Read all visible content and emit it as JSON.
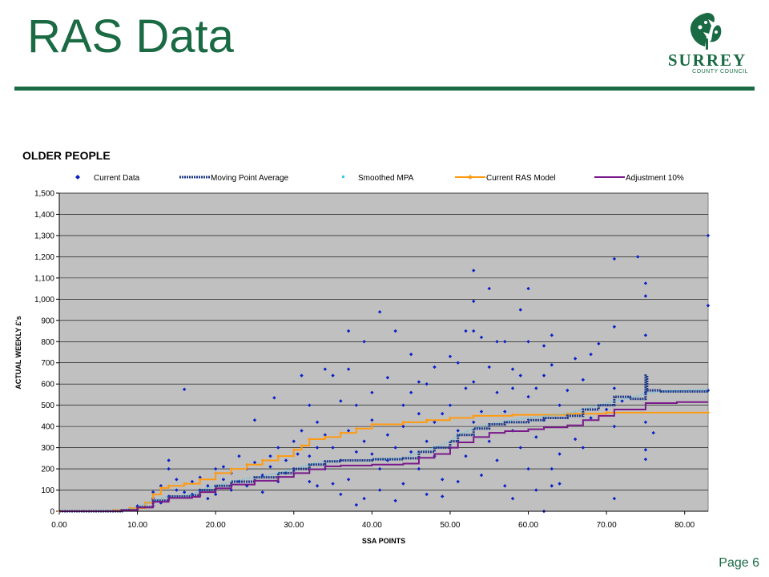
{
  "slide": {
    "title": "RAS Data",
    "page_label": "Page 6",
    "logo_name": "SURREY",
    "logo_sub": "COUNTY COUNCIL",
    "accent_color": "#1a6b44"
  },
  "chart_data": {
    "type": "scatter",
    "title": "OLDER PEOPLE",
    "xlabel": "SSA POINTS",
    "ylabel": "ACTUAL WEEKLY £'s",
    "xlim": [
      0,
      83
    ],
    "ylim": [
      0,
      1500
    ],
    "x_ticks": [
      "0.00",
      "10.00",
      "20.00",
      "30.00",
      "40.00",
      "50.00",
      "60.00",
      "70.00",
      "80.00"
    ],
    "y_ticks": [
      "0",
      "100",
      "200",
      "300",
      "400",
      "500",
      "600",
      "700",
      "800",
      "900",
      "1,000",
      "1,100",
      "1,200",
      "1,300",
      "1,400",
      "1,500"
    ],
    "grid": "horizontal",
    "plot_background": "#c0c0c0",
    "legend_position": "top",
    "legend": [
      "Current Data",
      "Moving Point Average",
      "Smoothed MPA",
      "Current RAS Model",
      "Adjustment 10%"
    ],
    "series": [
      {
        "name": "Current Data",
        "kind": "scatter",
        "color": "#0a1fc8",
        "points": [
          [
            9,
            10
          ],
          [
            10,
            25
          ],
          [
            11,
            20
          ],
          [
            12,
            60
          ],
          [
            12,
            90
          ],
          [
            13,
            120
          ],
          [
            13,
            40
          ],
          [
            14,
            200
          ],
          [
            14,
            240
          ],
          [
            14,
            70
          ],
          [
            15,
            100
          ],
          [
            15,
            150
          ],
          [
            16,
            575
          ],
          [
            16,
            90
          ],
          [
            17,
            80
          ],
          [
            17,
            140
          ],
          [
            18,
            100
          ],
          [
            18,
            160
          ],
          [
            19,
            120
          ],
          [
            19,
            60
          ],
          [
            20,
            200
          ],
          [
            20,
            80
          ],
          [
            21,
            150
          ],
          [
            21,
            210
          ],
          [
            22,
            100
          ],
          [
            22,
            180
          ],
          [
            23,
            140
          ],
          [
            23,
            260
          ],
          [
            24,
            200
          ],
          [
            24,
            120
          ],
          [
            25,
            430
          ],
          [
            25,
            230
          ],
          [
            26,
            90
          ],
          [
            26,
            170
          ],
          [
            27,
            260
          ],
          [
            27,
            210
          ],
          [
            27.5,
            535
          ],
          [
            28,
            140
          ],
          [
            28,
            300
          ],
          [
            29,
            240
          ],
          [
            29,
            180
          ],
          [
            30,
            200
          ],
          [
            30,
            330
          ],
          [
            30.5,
            270
          ],
          [
            31,
            640
          ],
          [
            31,
            380
          ],
          [
            32,
            500
          ],
          [
            32,
            140
          ],
          [
            32,
            260
          ],
          [
            33,
            420
          ],
          [
            33,
            300
          ],
          [
            33,
            120
          ],
          [
            34,
            670
          ],
          [
            34,
            200
          ],
          [
            34,
            360
          ],
          [
            35,
            640
          ],
          [
            35,
            130
          ],
          [
            35,
            300
          ],
          [
            36,
            520
          ],
          [
            36,
            240
          ],
          [
            36,
            80
          ],
          [
            37,
            850
          ],
          [
            37,
            670
          ],
          [
            37,
            380
          ],
          [
            37,
            150
          ],
          [
            38,
            500
          ],
          [
            38,
            280
          ],
          [
            38,
            30
          ],
          [
            39,
            800
          ],
          [
            39,
            330
          ],
          [
            39,
            60
          ],
          [
            40,
            560
          ],
          [
            40,
            270
          ],
          [
            40,
            430
          ],
          [
            41,
            940
          ],
          [
            41,
            200
          ],
          [
            41,
            100
          ],
          [
            42,
            630
          ],
          [
            42,
            360
          ],
          [
            42,
            240
          ],
          [
            43,
            850
          ],
          [
            43,
            300
          ],
          [
            43,
            50
          ],
          [
            44,
            500
          ],
          [
            44,
            400
          ],
          [
            44,
            130
          ],
          [
            45,
            740
          ],
          [
            45,
            280
          ],
          [
            45,
            560
          ],
          [
            46,
            460
          ],
          [
            46,
            200
          ],
          [
            46,
            610
          ],
          [
            47,
            600
          ],
          [
            47,
            330
          ],
          [
            47,
            80
          ],
          [
            48,
            680
          ],
          [
            48,
            420
          ],
          [
            48,
            260
          ],
          [
            49,
            460
          ],
          [
            49,
            150
          ],
          [
            49,
            70
          ],
          [
            50,
            730
          ],
          [
            50,
            500
          ],
          [
            50,
            300
          ],
          [
            51,
            700
          ],
          [
            51,
            380
          ],
          [
            51,
            140
          ],
          [
            52,
            580
          ],
          [
            52,
            260
          ],
          [
            52,
            850
          ],
          [
            53,
            1135
          ],
          [
            53,
            990
          ],
          [
            53,
            850
          ],
          [
            53,
            610
          ],
          [
            53,
            420
          ],
          [
            54,
            820
          ],
          [
            54,
            470
          ],
          [
            54,
            170
          ],
          [
            55,
            1050
          ],
          [
            55,
            680
          ],
          [
            55,
            330
          ],
          [
            56,
            800
          ],
          [
            56,
            560
          ],
          [
            56,
            240
          ],
          [
            57,
            800
          ],
          [
            57,
            470
          ],
          [
            57,
            120
          ],
          [
            58,
            670
          ],
          [
            58,
            580
          ],
          [
            58,
            380
          ],
          [
            58,
            60
          ],
          [
            59,
            950
          ],
          [
            59,
            640
          ],
          [
            59,
            300
          ],
          [
            60,
            1050
          ],
          [
            60,
            800
          ],
          [
            60,
            540
          ],
          [
            60,
            200
          ],
          [
            61,
            580
          ],
          [
            61,
            350
          ],
          [
            61,
            100
          ],
          [
            62,
            780
          ],
          [
            62,
            640
          ],
          [
            62,
            430
          ],
          [
            62,
            0
          ],
          [
            63,
            830
          ],
          [
            63,
            690
          ],
          [
            63,
            200
          ],
          [
            63,
            120
          ],
          [
            64,
            500
          ],
          [
            64,
            270
          ],
          [
            64,
            130
          ],
          [
            65,
            570
          ],
          [
            66,
            720
          ],
          [
            66,
            340
          ],
          [
            67,
            300
          ],
          [
            67,
            620
          ],
          [
            68,
            740
          ],
          [
            68,
            440
          ],
          [
            69,
            790
          ],
          [
            70,
            480
          ],
          [
            71,
            1190
          ],
          [
            71,
            870
          ],
          [
            71,
            580
          ],
          [
            71,
            400
          ],
          [
            71,
            60
          ],
          [
            72,
            520
          ],
          [
            74,
            1200
          ],
          [
            75,
            1075
          ],
          [
            75,
            1015
          ],
          [
            75,
            830
          ],
          [
            75,
            560
          ],
          [
            75,
            420
          ],
          [
            75,
            290
          ],
          [
            75,
            245
          ],
          [
            76,
            370
          ],
          [
            83,
            1300
          ],
          [
            83,
            970
          ],
          [
            83,
            570
          ]
        ]
      },
      {
        "name": "Moving Point Average",
        "kind": "step",
        "color": "#203a8a",
        "points": [
          [
            0,
            0
          ],
          [
            8,
            5
          ],
          [
            10,
            20
          ],
          [
            12,
            50
          ],
          [
            14,
            70
          ],
          [
            17,
            75
          ],
          [
            18,
            100
          ],
          [
            20,
            120
          ],
          [
            22,
            140
          ],
          [
            25,
            160
          ],
          [
            28,
            180
          ],
          [
            30,
            200
          ],
          [
            32,
            220
          ],
          [
            34,
            235
          ],
          [
            36,
            240
          ],
          [
            40,
            245
          ],
          [
            44,
            250
          ],
          [
            46,
            280
          ],
          [
            48,
            300
          ],
          [
            50,
            330
          ],
          [
            51,
            360
          ],
          [
            53,
            390
          ],
          [
            55,
            410
          ],
          [
            57,
            420
          ],
          [
            60,
            430
          ],
          [
            62,
            440
          ],
          [
            65,
            450
          ],
          [
            67,
            480
          ],
          [
            69,
            500
          ],
          [
            71,
            540
          ],
          [
            73,
            530
          ],
          [
            75,
            640
          ],
          [
            75.2,
            570
          ],
          [
            77,
            565
          ],
          [
            83,
            570
          ]
        ]
      },
      {
        "name": "Smoothed MPA",
        "kind": "line",
        "color": "#38c8f0",
        "points": [
          [
            0,
            0
          ],
          [
            8,
            5
          ],
          [
            10,
            20
          ],
          [
            12,
            50
          ],
          [
            14,
            70
          ],
          [
            17,
            78
          ],
          [
            18,
            100
          ],
          [
            20,
            120
          ],
          [
            22,
            140
          ],
          [
            25,
            160
          ],
          [
            28,
            180
          ],
          [
            30,
            200
          ],
          [
            32,
            220
          ],
          [
            34,
            235
          ],
          [
            36,
            240
          ],
          [
            40,
            245
          ],
          [
            44,
            250
          ],
          [
            46,
            280
          ],
          [
            48,
            300
          ],
          [
            50,
            330
          ],
          [
            51,
            360
          ],
          [
            53,
            390
          ],
          [
            55,
            410
          ],
          [
            57,
            425
          ],
          [
            60,
            440
          ],
          [
            62,
            450
          ],
          [
            65,
            460
          ],
          [
            67,
            480
          ],
          [
            69,
            500
          ],
          [
            71,
            520
          ],
          [
            73,
            535
          ],
          [
            75,
            555
          ],
          [
            77,
            565
          ],
          [
            83,
            575
          ]
        ]
      },
      {
        "name": "Current RAS Model",
        "kind": "step",
        "color": "#ff9a10",
        "points": [
          [
            0,
            0
          ],
          [
            7,
            5
          ],
          [
            9,
            15
          ],
          [
            11,
            40
          ],
          [
            12,
            80
          ],
          [
            13,
            110
          ],
          [
            14,
            120
          ],
          [
            16,
            130
          ],
          [
            18,
            150
          ],
          [
            20,
            180
          ],
          [
            22,
            200
          ],
          [
            24,
            220
          ],
          [
            26,
            240
          ],
          [
            28,
            260
          ],
          [
            30,
            290
          ],
          [
            31,
            310
          ],
          [
            32,
            340
          ],
          [
            34,
            350
          ],
          [
            36,
            370
          ],
          [
            38,
            390
          ],
          [
            40,
            410
          ],
          [
            44,
            420
          ],
          [
            47,
            430
          ],
          [
            50,
            440
          ],
          [
            53,
            450
          ],
          [
            58,
            455
          ],
          [
            65,
            460
          ],
          [
            70,
            465
          ],
          [
            83,
            465
          ]
        ]
      },
      {
        "name": "Adjustment 10%",
        "kind": "step",
        "color": "#7a1a8a",
        "points": [
          [
            0,
            0
          ],
          [
            8,
            5
          ],
          [
            10,
            18
          ],
          [
            12,
            45
          ],
          [
            14,
            63
          ],
          [
            17,
            68
          ],
          [
            18,
            90
          ],
          [
            20,
            108
          ],
          [
            22,
            126
          ],
          [
            25,
            144
          ],
          [
            28,
            162
          ],
          [
            30,
            180
          ],
          [
            32,
            198
          ],
          [
            34,
            212
          ],
          [
            36,
            216
          ],
          [
            40,
            220
          ],
          [
            44,
            225
          ],
          [
            46,
            252
          ],
          [
            48,
            270
          ],
          [
            50,
            300
          ],
          [
            51,
            325
          ],
          [
            53,
            350
          ],
          [
            55,
            370
          ],
          [
            57,
            378
          ],
          [
            60,
            387
          ],
          [
            62,
            396
          ],
          [
            65,
            405
          ],
          [
            67,
            430
          ],
          [
            69,
            450
          ],
          [
            71,
            480
          ],
          [
            73,
            480
          ],
          [
            75,
            510
          ],
          [
            77,
            510
          ],
          [
            79,
            515
          ],
          [
            83,
            515
          ]
        ]
      }
    ]
  }
}
